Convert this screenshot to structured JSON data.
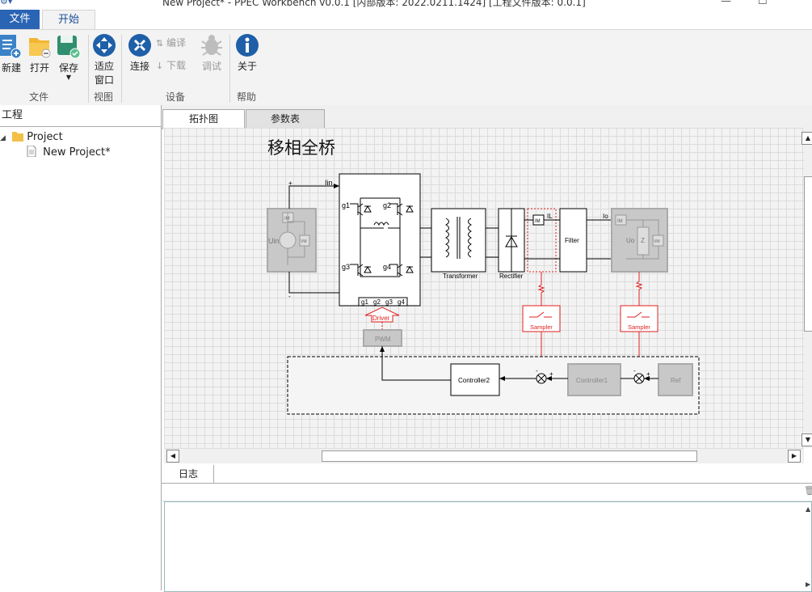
{
  "window": {
    "title": "New Project* - PPEC Workbench v0.0.1 [内部版本: 2022.0211.1424] [工程文件版本: 0.0.1]",
    "minimize": "—",
    "maximize": "☐"
  },
  "ribbon_tabs": {
    "file": "文件",
    "start": "开始"
  },
  "ribbon": {
    "new": "新建",
    "open": "打开",
    "save": "保存",
    "fit_line1": "适应",
    "fit_line2": "窗口",
    "connect": "连接",
    "compile": "编译",
    "download": "下载",
    "debug": "调试",
    "about": "关于",
    "groups": {
      "file": "文件",
      "view": "视图",
      "device": "设备",
      "help": "帮助"
    }
  },
  "project_panel": {
    "title": "工程",
    "root": "Project",
    "child": "New Project*"
  },
  "doc_tabs": {
    "topology": "拓扑图",
    "params": "参数表"
  },
  "diagram": {
    "title": "移相全桥",
    "plus": "+",
    "minus": "-",
    "iin": "Iin",
    "uin": "Uin",
    "im": "IM",
    "vm": "VM",
    "g1": "g1",
    "g2": "g2",
    "g3": "g3",
    "g4": "g4",
    "transformer": "Transformer",
    "rectifier": "Rectifier",
    "filter": "Filter",
    "il": "IL",
    "io": "Io",
    "uo": "Uo",
    "z": "Z",
    "driver": "Driver",
    "pwm": "PWM",
    "sampler": "Sampler",
    "controller2": "Controller2",
    "controller1": "Controller1",
    "ref": "Ref"
  },
  "log_panel": {
    "tab": "日志"
  },
  "colors": {
    "accent": "#2a64b4",
    "signal_red": "#e02020",
    "component_gray": "#c8c8c8"
  }
}
